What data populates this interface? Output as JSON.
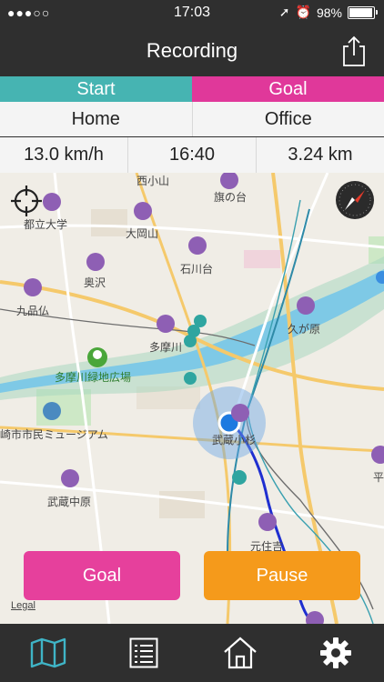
{
  "status_bar": {
    "signal": "●●●○○",
    "time": "17:03",
    "battery": "98%",
    "battery_level": 0.98
  },
  "nav": {
    "title": "Recording"
  },
  "route": {
    "start_label": "Start",
    "goal_label": "Goal",
    "start_place": "Home",
    "goal_place": "Office"
  },
  "stats": {
    "speed": "13.0 km/h",
    "time": "16:40",
    "distance": "3.24 km"
  },
  "map": {
    "labels": {
      "nishikoyama": "西小山",
      "hatanodai": "旗の台",
      "toritsudaigaku": "都立大学",
      "ookayama": "大岡山",
      "ishikawadai": "石川台",
      "okusawa": "奥沢",
      "kuhonbutsu": "九品仏",
      "kugahara": "久が原",
      "tamagawa": "多摩川",
      "tamagawa_ryokuchi": "多摩川緑地広場",
      "museum": "崎市市民ミュージアム",
      "musashi_kosugi": "武蔵小杉",
      "musashi_nakahara": "武蔵中原",
      "motosumiyoshi": "元住吉",
      "hira": "平"
    },
    "legal": "Legal"
  },
  "buttons": {
    "goal": "Goal",
    "pause": "Pause"
  },
  "colors": {
    "start": "#46b4b2",
    "goal": "#e0389a",
    "pause": "#f59a1b",
    "bar": "#2f2f2f"
  },
  "tabs": [
    "map-icon",
    "list-icon",
    "home-icon",
    "gear-icon"
  ]
}
